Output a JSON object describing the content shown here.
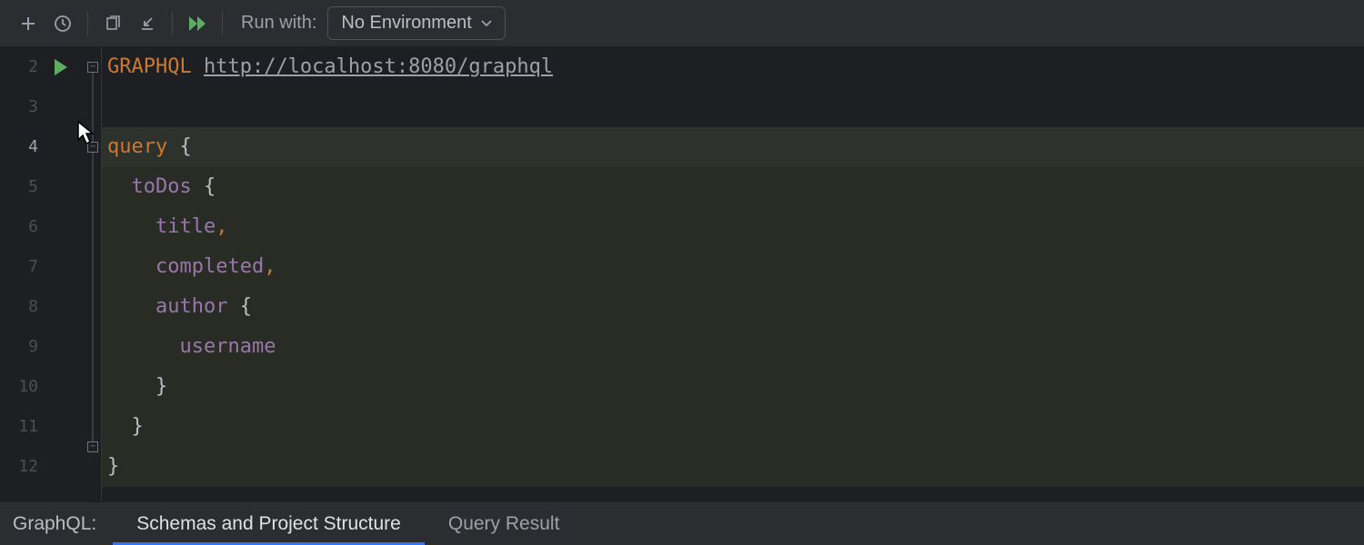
{
  "toolbar": {
    "run_with_label": "Run with:",
    "environment": "No Environment"
  },
  "editor": {
    "line_numbers": [
      "2",
      "3",
      "4",
      "5",
      "6",
      "7",
      "8",
      "9",
      "10",
      "11",
      "12"
    ],
    "active_line_index": 2,
    "request": {
      "method": "GRAPHQL",
      "url": "http://localhost:8080/graphql"
    },
    "code": {
      "l4_kw": "query",
      "l4_rest": " {",
      "l5_field": "toDos",
      "l5_rest": " {",
      "l6_field": "title",
      "l6_rest": ",",
      "l7_field": "completed",
      "l7_rest": ",",
      "l8_field": "author",
      "l8_rest": " {",
      "l9_field": "username",
      "l10_rest": "}",
      "l11_rest": "}",
      "l12_rest": "}"
    }
  },
  "bottom": {
    "tool_label": "GraphQL:",
    "tabs": [
      "Schemas and Project Structure",
      "Query Result"
    ],
    "active_tab_index": 0
  }
}
